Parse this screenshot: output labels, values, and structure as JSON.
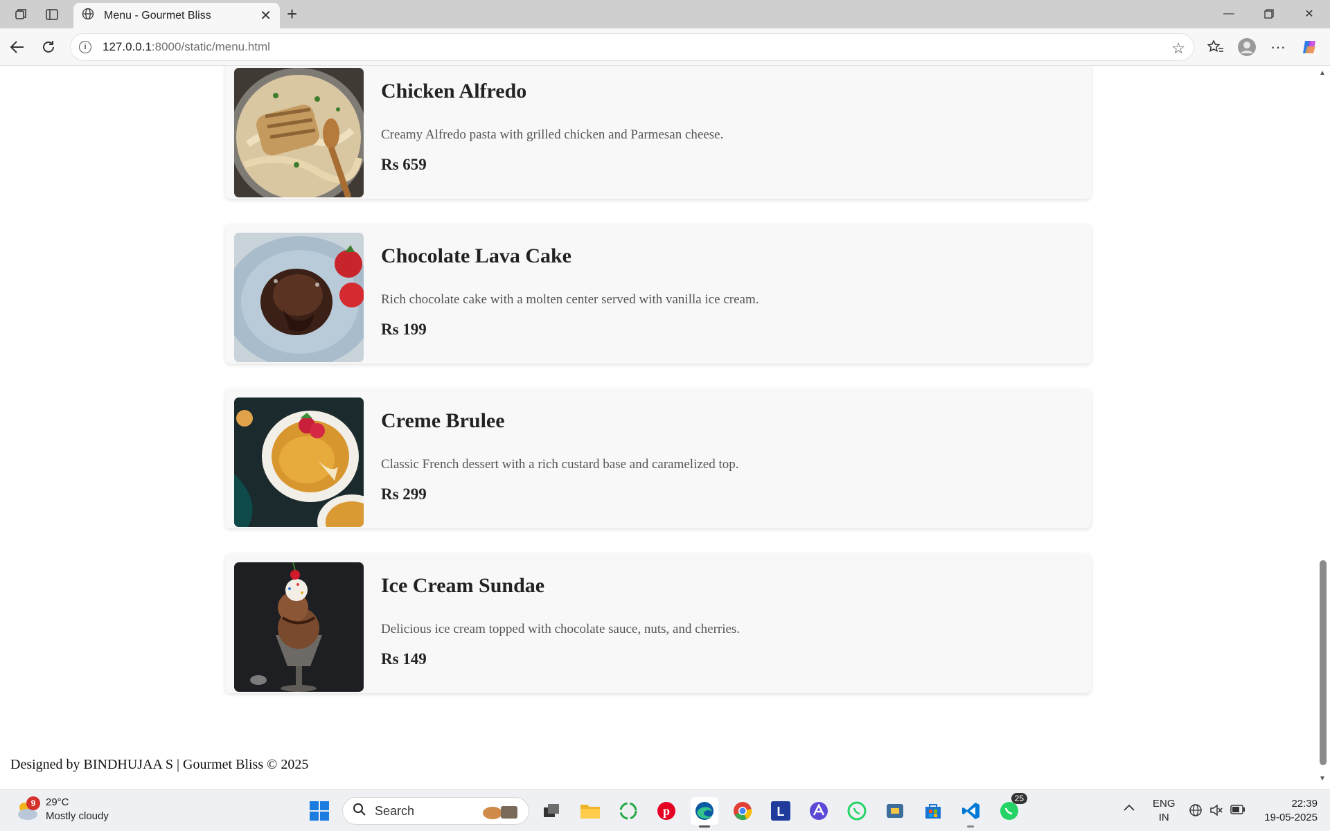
{
  "browser": {
    "tab_title": "Menu - Gourmet Bliss",
    "url_host": "127.0.0.1",
    "url_rest": ":8000/static/menu.html"
  },
  "menu": {
    "items": [
      {
        "name": "Chicken Alfredo",
        "description": "Creamy Alfredo pasta with grilled chicken and Parmesan cheese.",
        "price": "Rs 659"
      },
      {
        "name": "Chocolate Lava Cake",
        "description": "Rich chocolate cake with a molten center served with vanilla ice cream.",
        "price": "Rs 199"
      },
      {
        "name": "Creme Brulee",
        "description": "Classic French dessert with a rich custard base and caramelized top.",
        "price": "Rs 299"
      },
      {
        "name": "Ice Cream Sundae",
        "description": "Delicious ice cream topped with chocolate sauce, nuts, and cherries.",
        "price": "Rs 149"
      }
    ]
  },
  "footer": {
    "text": "Designed by BINDHUJAA S | Gourmet Bliss © 2025"
  },
  "taskbar": {
    "weather_badge": "9",
    "temperature": "29°C",
    "condition": "Mostly cloudy",
    "search_label": "Search",
    "whatsapp_badge": "25",
    "lang_top": "ENG",
    "lang_bottom": "IN",
    "time": "22:39",
    "date": "19-05-2025"
  },
  "colors": {
    "card_bg": "#f8f8f8",
    "edge_blue": "#0c59a4",
    "pinterest_red": "#e60023",
    "whatsapp_green": "#25d366",
    "vscode_blue": "#0078d4"
  }
}
